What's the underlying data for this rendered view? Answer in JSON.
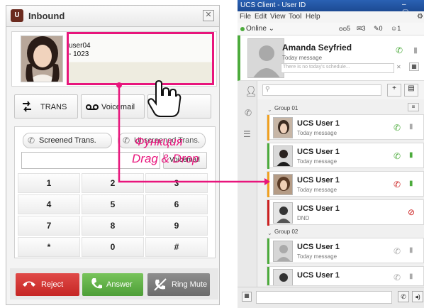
{
  "inbound": {
    "title": "Inbound",
    "app_icon": "U",
    "close_glyph": "✕",
    "caller_name": "user04",
    "caller_number": "- 1023",
    "buttons": {
      "trans": "TRANS",
      "voicemail": "Voicemail"
    },
    "screened_label": "Screened Trans.",
    "unscreened_label": "Unscreened Trans.",
    "voicemail_small": "Voicemail",
    "keypad": [
      "1",
      "2",
      "3",
      "4",
      "5",
      "6",
      "7",
      "8",
      "9",
      "*",
      "0",
      "#"
    ],
    "actions": {
      "reject": "Reject",
      "answer": "Answer",
      "ring_mute": "Ring Mute"
    }
  },
  "annotation": {
    "line1": "Функция",
    "line2": "Drag & Drop",
    "accent": "#e8157c"
  },
  "ucs": {
    "title": "UCS Client - User ID",
    "menus": [
      "File",
      "Edit",
      "View",
      "Tool",
      "Help"
    ],
    "status": "Online",
    "counts": [
      "5",
      "3",
      "0",
      "1"
    ],
    "profile": {
      "name": "Amanda Seyfried",
      "message": "Today message",
      "schedule_placeholder": "There is no today's schedule..."
    },
    "groups": [
      {
        "label": "Group 01",
        "users": [
          {
            "name": "UCS User 1",
            "message": "Today message",
            "status_color": "#f0a020"
          },
          {
            "name": "UCS User 1",
            "message": "Today message",
            "status_color": "#4cab3c"
          },
          {
            "name": "UCS User 1",
            "message": "Today message",
            "status_color": "#f0a020"
          },
          {
            "name": "UCS User 1",
            "message": "DND",
            "status_color": "#cc2222"
          }
        ]
      },
      {
        "label": "Group 02",
        "users": [
          {
            "name": "UCS User 1",
            "message": "Today message",
            "status_color": "#4cab3c"
          },
          {
            "name": "UCS User 1",
            "message": "",
            "status_color": "#4cab3c"
          }
        ]
      }
    ]
  }
}
